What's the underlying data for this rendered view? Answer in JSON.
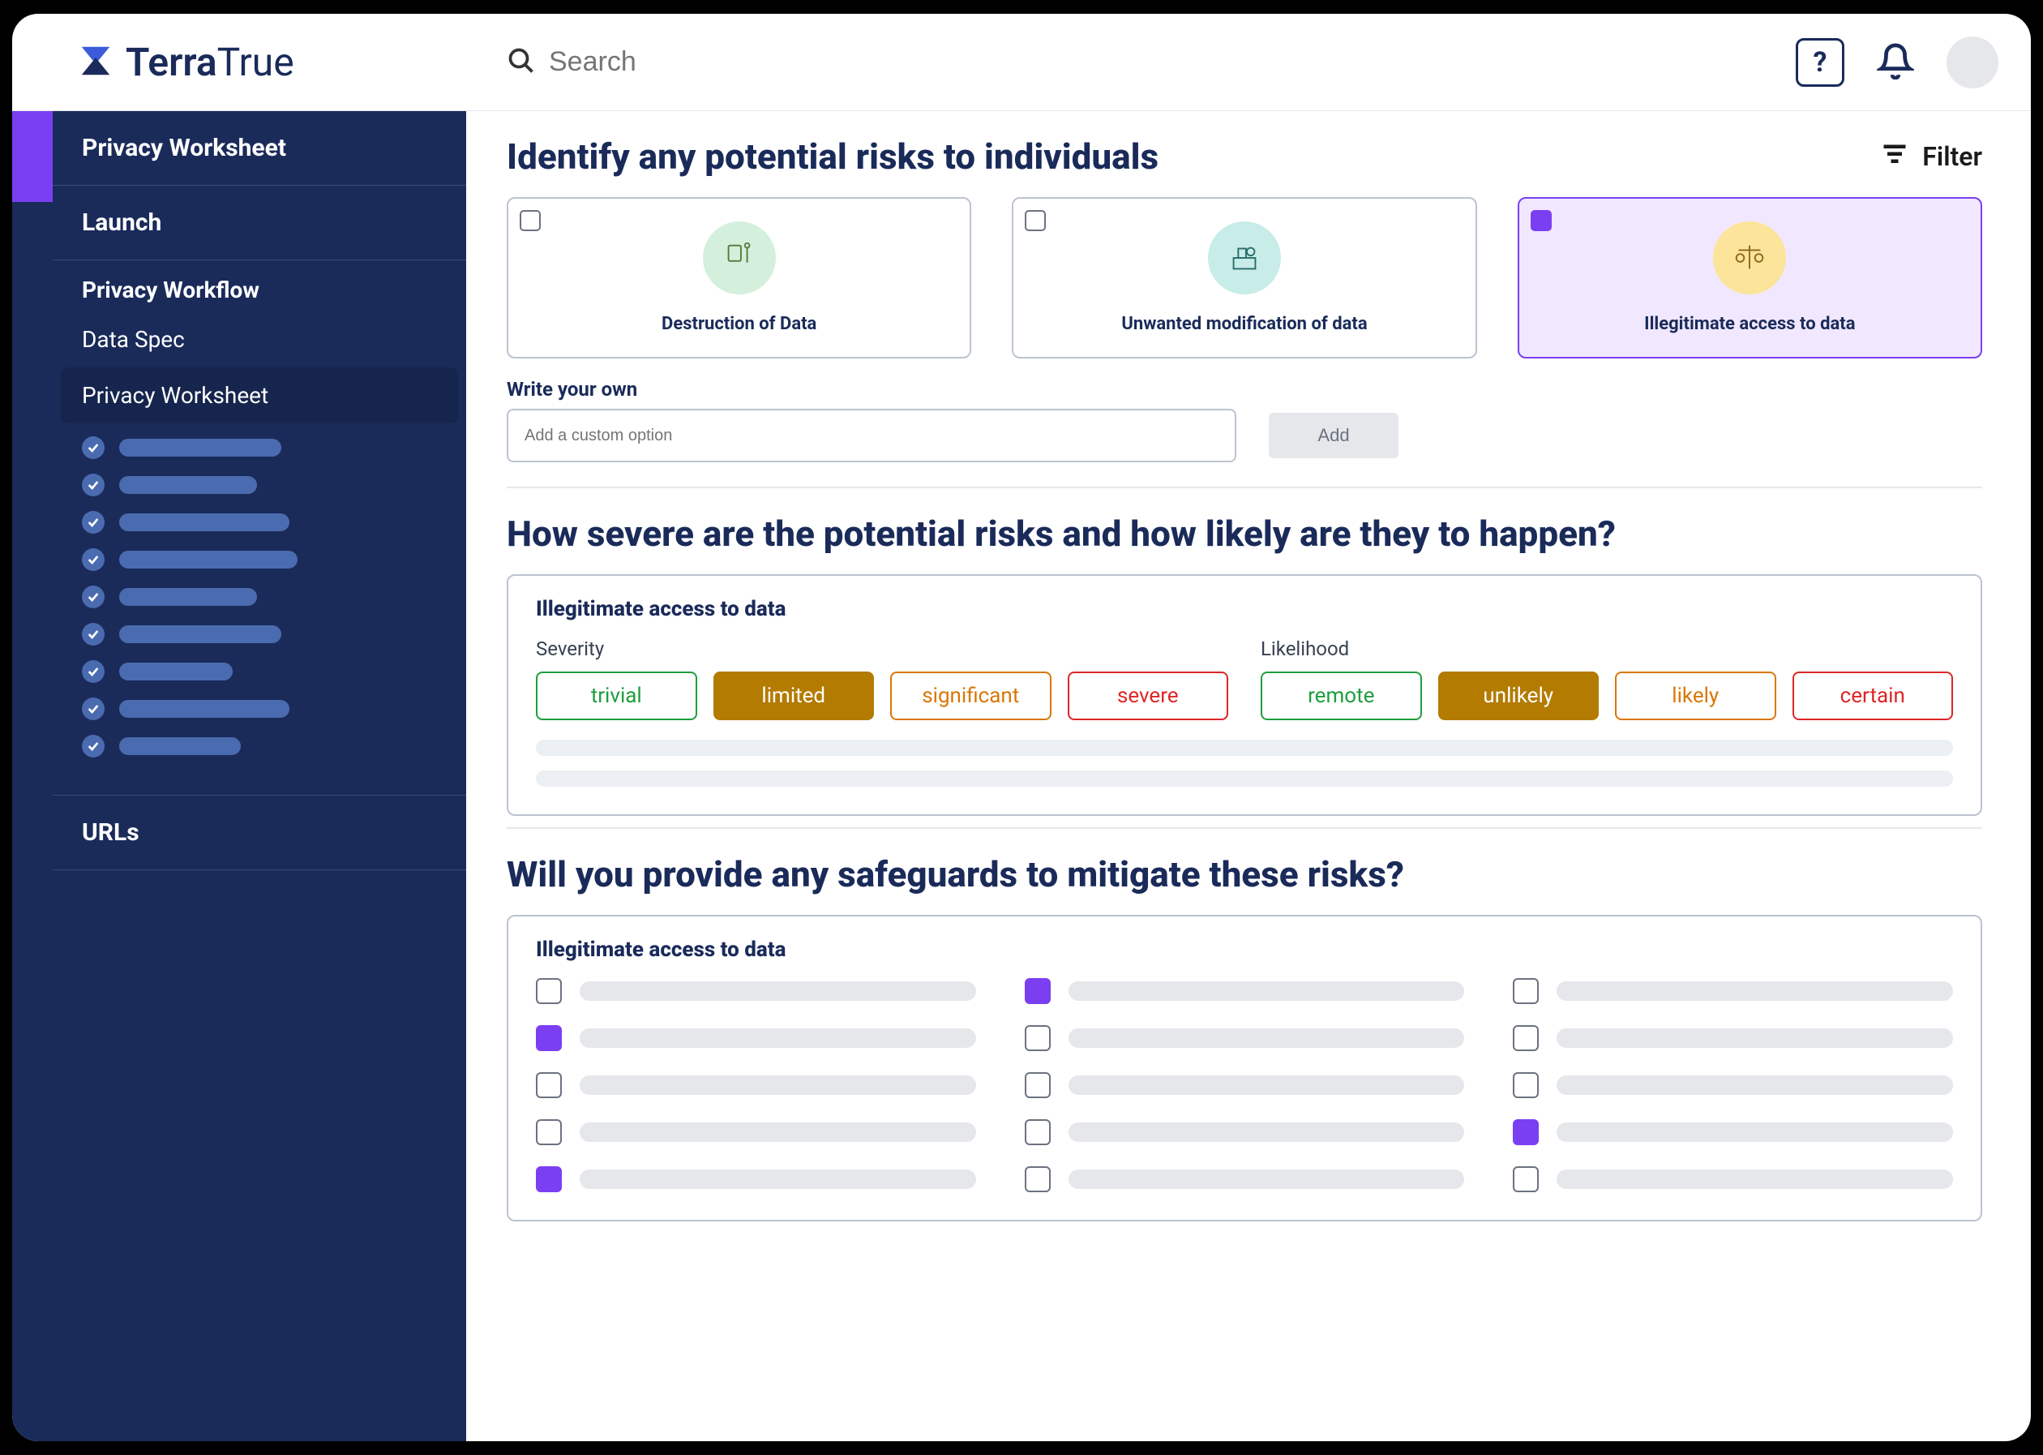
{
  "brand": {
    "name_a": "Terra",
    "name_b": "True"
  },
  "search": {
    "placeholder": "Search"
  },
  "topbar": {
    "help_label": "?",
    "filter_label": "Filter"
  },
  "sidebar": {
    "header": "Privacy Worksheet",
    "launch": "Launch",
    "workflow_label": "Privacy Workflow",
    "data_spec": "Data Spec",
    "privacy_worksheet": "Privacy Worksheet",
    "urls": "URLs",
    "check_widths": [
      200,
      170,
      210,
      220,
      170,
      200,
      140,
      210,
      150
    ]
  },
  "section1": {
    "title": "Identify any potential risks to individuals",
    "cards": [
      {
        "label": "Destruction of Data",
        "selected": false,
        "icon_color": "green"
      },
      {
        "label": "Unwanted modification of data",
        "selected": false,
        "icon_color": "teal"
      },
      {
        "label": "Illegitimate access to data",
        "selected": true,
        "icon_color": "yellow"
      }
    ],
    "write_label": "Write your own",
    "write_placeholder": "Add a custom option",
    "add_label": "Add"
  },
  "section2": {
    "title": "How severe are the potential risks and how likely are they to happen?",
    "subtitle": "Illegitimate access to data",
    "severity_label": "Severity",
    "likelihood_label": "Likelihood",
    "severity": [
      {
        "text": "trivial",
        "style": "green"
      },
      {
        "text": "limited",
        "style": "amber-filled"
      },
      {
        "text": "significant",
        "style": "orange"
      },
      {
        "text": "severe",
        "style": "red"
      }
    ],
    "likelihood": [
      {
        "text": "remote",
        "style": "green"
      },
      {
        "text": "unlikely",
        "style": "amber-filled"
      },
      {
        "text": "likely",
        "style": "orange"
      },
      {
        "text": "certain",
        "style": "red"
      }
    ]
  },
  "section3": {
    "title": "Will you provide any safeguards to mitigate these risks?",
    "subtitle": "Illegitimate access to data",
    "items": [
      {
        "checked": false
      },
      {
        "checked": true
      },
      {
        "checked": false
      },
      {
        "checked": true
      },
      {
        "checked": false
      },
      {
        "checked": false
      },
      {
        "checked": false
      },
      {
        "checked": false
      },
      {
        "checked": false
      },
      {
        "checked": false
      },
      {
        "checked": false
      },
      {
        "checked": true
      },
      {
        "checked": true
      },
      {
        "checked": false
      },
      {
        "checked": false
      }
    ]
  }
}
